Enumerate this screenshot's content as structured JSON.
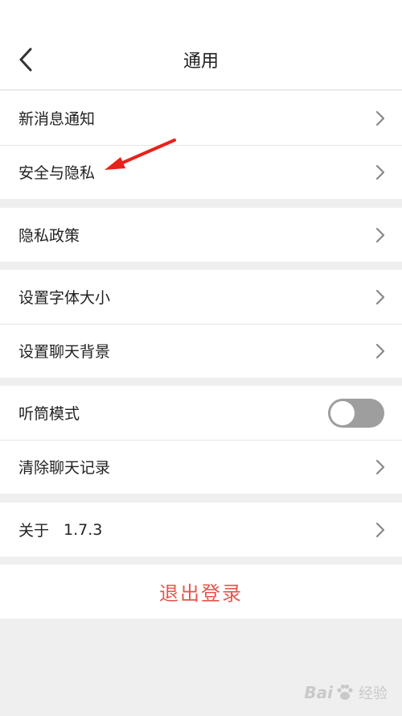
{
  "header": {
    "title": "通用"
  },
  "groups": [
    {
      "rows": [
        {
          "label": "新消息通知"
        },
        {
          "label": "安全与隐私"
        }
      ]
    },
    {
      "rows": [
        {
          "label": "隐私政策"
        }
      ]
    },
    {
      "rows": [
        {
          "label": "设置字体大小"
        },
        {
          "label": "设置聊天背景"
        }
      ]
    },
    {
      "rows": [
        {
          "label": "听筒模式",
          "toggle": false
        },
        {
          "label": "清除聊天记录"
        }
      ]
    },
    {
      "rows": [
        {
          "label": "关于",
          "value": "1.7.3"
        }
      ]
    }
  ],
  "logout": {
    "label": "退出登录"
  },
  "colors": {
    "logout_text": "#e5574b",
    "annotation_arrow": "#e8221b",
    "toggle_off": "#9e9e9e"
  },
  "icons": {
    "back": "chevron-left-icon",
    "row": "chevron-right-icon",
    "annotation": "red-arrow-icon"
  },
  "watermark": {
    "brand_left": "Bai",
    "brand_right": "经验"
  }
}
